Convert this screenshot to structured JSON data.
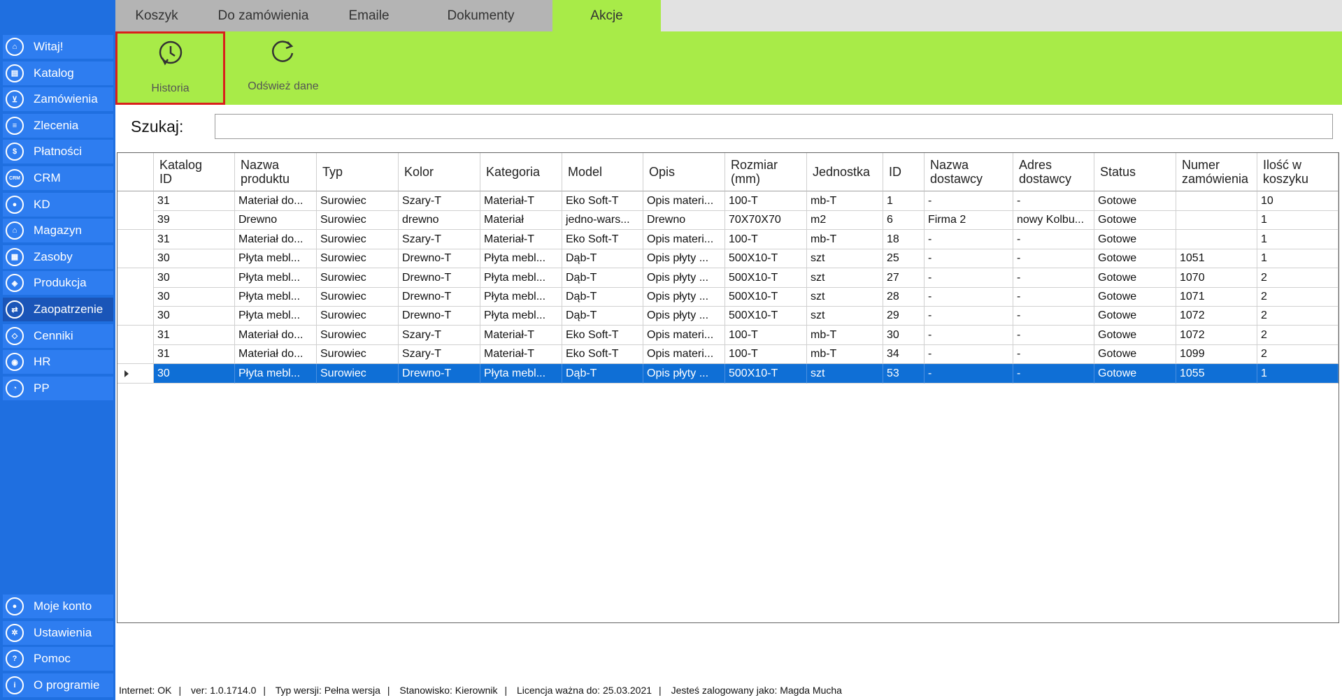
{
  "sidebar": {
    "items": [
      {
        "label": "Witaj!",
        "icon": "home-icon",
        "glyph": "⌂"
      },
      {
        "label": "Katalog",
        "icon": "catalog-icon",
        "glyph": "▤"
      },
      {
        "label": "Zamówienia",
        "icon": "cart-icon",
        "glyph": "⊻"
      },
      {
        "label": "Zlecenia",
        "icon": "list-icon",
        "glyph": "≡"
      },
      {
        "label": "Płatności",
        "icon": "dollar-icon",
        "glyph": "$"
      },
      {
        "label": "CRM",
        "icon": "crm-icon",
        "glyph": "CRM"
      },
      {
        "label": "KD",
        "icon": "user-icon",
        "glyph": "●"
      },
      {
        "label": "Magazyn",
        "icon": "warehouse-icon",
        "glyph": "⌂"
      },
      {
        "label": "Zasoby",
        "icon": "resources-icon",
        "glyph": "▦"
      },
      {
        "label": "Produkcja",
        "icon": "production-icon",
        "glyph": "◈"
      },
      {
        "label": "Zaopatrzenie",
        "icon": "truck-icon",
        "glyph": "⇄"
      },
      {
        "label": "Cenniki",
        "icon": "tag-icon",
        "glyph": "◇"
      },
      {
        "label": "HR",
        "icon": "hr-icon",
        "glyph": "◉"
      },
      {
        "label": "PP",
        "icon": "pp-icon",
        "glyph": "◔"
      }
    ],
    "bottom_items": [
      {
        "label": "Moje konto",
        "icon": "account-icon",
        "glyph": "●"
      },
      {
        "label": "Ustawienia",
        "icon": "gear-icon",
        "glyph": "✲"
      },
      {
        "label": "Pomoc",
        "icon": "help-icon",
        "glyph": "?"
      },
      {
        "label": "O programie",
        "icon": "info-icon",
        "glyph": "i"
      }
    ],
    "active": "Zaopatrzenie"
  },
  "tabs": [
    "Koszyk",
    "Do zamówienia",
    "Emaile",
    "Dokumenty",
    "Akcje"
  ],
  "active_tab": "Akcje",
  "ribbon": {
    "historia_label": "Historia",
    "odswiez_label": "Odśwież dane"
  },
  "search": {
    "label": "Szukaj:",
    "value": ""
  },
  "grid": {
    "columns": [
      "Katalog\nID",
      "Nazwa\nproduktu",
      "Typ",
      "Kolor",
      "Kategoria",
      "Model",
      "Opis",
      "Rozmiar\n(mm)",
      "Jednostka",
      "ID",
      "Nazwa\ndostawcy",
      "Adres\ndostawcy",
      "Status",
      "Numer\nzamówienia",
      "Ilość w\nkoszyku"
    ],
    "rows": [
      [
        "31",
        "Materiał do...",
        "Surowiec",
        "Szary-T",
        "Materiał-T",
        "Eko Soft-T",
        "Opis materi...",
        "100-T",
        "mb-T",
        "1",
        "-",
        "-",
        "Gotowe",
        "",
        "10"
      ],
      [
        "39",
        "Drewno",
        "Surowiec",
        "drewno",
        "Materiał",
        "jedno-wars...",
        "Drewno",
        "70X70X70",
        "m2",
        "6",
        "Firma 2",
        "nowy Kolbu...",
        "Gotowe",
        "",
        "1"
      ],
      [
        "31",
        "Materiał do...",
        "Surowiec",
        "Szary-T",
        "Materiał-T",
        "Eko Soft-T",
        "Opis materi...",
        "100-T",
        "mb-T",
        "18",
        "-",
        "-",
        "Gotowe",
        "",
        "1"
      ],
      [
        "30",
        "Płyta mebl...",
        "Surowiec",
        "Drewno-T",
        "Płyta mebl...",
        "Dąb-T",
        "Opis płyty ...",
        "500X10-T",
        "szt",
        "25",
        "-",
        "-",
        "Gotowe",
        "1051",
        "1"
      ],
      [
        "30",
        "Płyta mebl...",
        "Surowiec",
        "Drewno-T",
        "Płyta mebl...",
        "Dąb-T",
        "Opis płyty ...",
        "500X10-T",
        "szt",
        "27",
        "-",
        "-",
        "Gotowe",
        "1070",
        "2"
      ],
      [
        "30",
        "Płyta mebl...",
        "Surowiec",
        "Drewno-T",
        "Płyta mebl...",
        "Dąb-T",
        "Opis płyty ...",
        "500X10-T",
        "szt",
        "28",
        "-",
        "-",
        "Gotowe",
        "1071",
        "2"
      ],
      [
        "30",
        "Płyta mebl...",
        "Surowiec",
        "Drewno-T",
        "Płyta mebl...",
        "Dąb-T",
        "Opis płyty ...",
        "500X10-T",
        "szt",
        "29",
        "-",
        "-",
        "Gotowe",
        "1072",
        "2"
      ],
      [
        "31",
        "Materiał do...",
        "Surowiec",
        "Szary-T",
        "Materiał-T",
        "Eko Soft-T",
        "Opis materi...",
        "100-T",
        "mb-T",
        "30",
        "-",
        "-",
        "Gotowe",
        "1072",
        "2"
      ],
      [
        "31",
        "Materiał do...",
        "Surowiec",
        "Szary-T",
        "Materiał-T",
        "Eko Soft-T",
        "Opis materi...",
        "100-T",
        "mb-T",
        "34",
        "-",
        "-",
        "Gotowe",
        "1099",
        "2"
      ],
      [
        "30",
        "Płyta mebl...",
        "Surowiec",
        "Drewno-T",
        "Płyta mebl...",
        "Dąb-T",
        "Opis płyty ...",
        "500X10-T",
        "szt",
        "53",
        "-",
        "-",
        "Gotowe",
        "1055",
        "1"
      ]
    ],
    "selected_row": 9
  },
  "statusbar": {
    "internet": "Internet: OK",
    "version": "ver: 1.0.1714.0",
    "typ_wersji": "Typ wersji: Pełna wersja",
    "stanowisko": "Stanowisko: Kierownik",
    "licencja": "Licencja ważna do: 25.03.2021",
    "user": "Jesteś zalogowany jako: Magda Mucha"
  },
  "colors": {
    "sidebar_bg": "#1f6fe0",
    "sidebar_item": "#2e7df0",
    "sidebar_active": "#1a55b8",
    "accent_green": "#a8eb48",
    "selection_blue": "#0f6fd6",
    "highlight_red": "#d9201b"
  }
}
